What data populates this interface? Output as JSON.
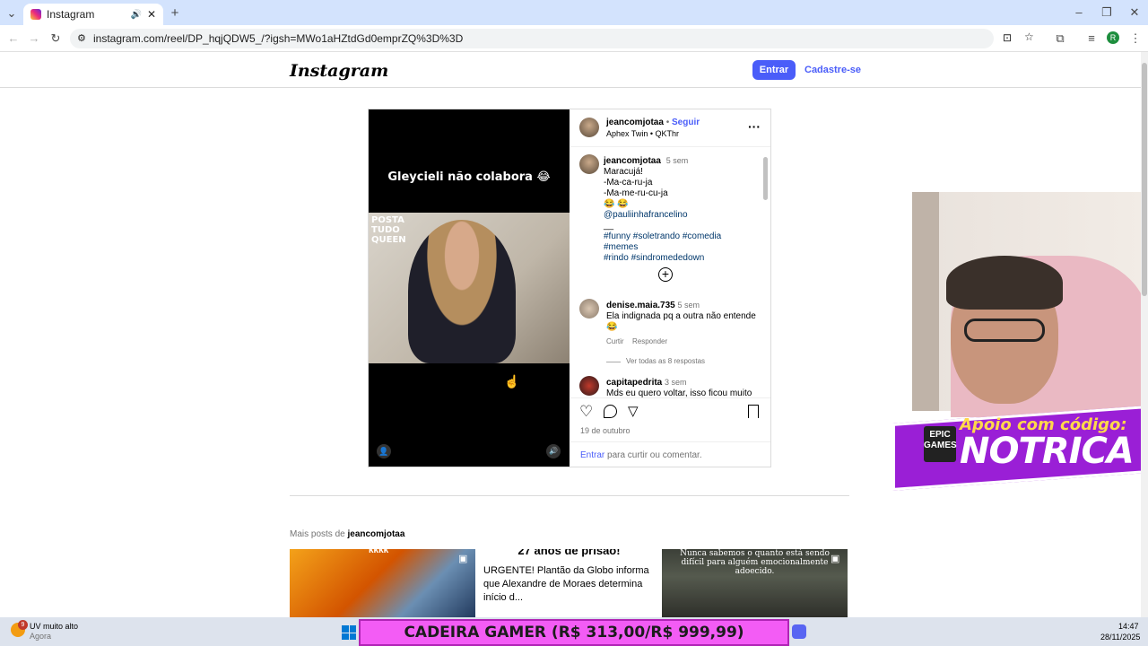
{
  "browser": {
    "tab_title": "Instagram",
    "url": "instagram.com/reel/DP_hqjQDW5_/?igsh=MWo1aHZtdGd0emprZQ%3D%3D"
  },
  "instagram": {
    "logo": "Instagram",
    "login_label": "Entrar",
    "signup_label": "Cadastre-se"
  },
  "post": {
    "video_caption": "Gleycieli não colabora 😂",
    "watermark": "POSTA TUDO QUEEN",
    "author": "jeancomjotaa",
    "follow_label": "Seguir",
    "dot": "•",
    "audio": "Aphex Twin • QKThr",
    "caption": {
      "user": "jeancomjotaa",
      "time": "5 sem",
      "lines": [
        "Maracujá!",
        "-Ma-ca-ru-ja",
        "-Ma-me-ru-cu-ja",
        "😂 😂"
      ],
      "mention": "@pauliinhafrancelino",
      "dash": "__",
      "hashtags_1": "#funny #soletrando #comedia #memes",
      "hashtags_2": "#rindo #sindromededown"
    },
    "comments": [
      {
        "user": "denise.maia.735",
        "time": "5 sem",
        "text_1": "Ela indignada pq a outra não entende",
        "text_2": "😂",
        "like": "Curtir",
        "reply": "Responder",
        "view_replies": "Ver todas as 8 respostas"
      },
      {
        "user": "capitapedrita",
        "time": "3 sem",
        "text_1": "Mds eu quero voltar, isso ficou muito"
      }
    ],
    "date": "19 de outubro",
    "login_prompt_link": "Entrar",
    "login_prompt_rest": " para curtir ou comentar."
  },
  "more_posts": {
    "label": "Mais posts de ",
    "user": "jeancomjotaa",
    "thumb1_text": "kkkk",
    "thumb2_title": "27 anos de prisão!",
    "thumb2_body": "URGENTE! Plantão da Globo informa que Alexandre de Moraes determina início d...",
    "thumb3_text": "Nunca sabemos o quanto está sendo difícil para alguém emocionalmente adoecido."
  },
  "overlay": {
    "apoio": "Apoio com código:",
    "code": "NOTRICA",
    "epic": "EPIC GAMES",
    "promo": "CADEIRA GAMER (R$ 313,00/R$ 999,99)"
  },
  "taskbar": {
    "weather": "UV muito alto",
    "weather_sub": "Agora",
    "badge": "9",
    "time": "14:47",
    "date": "28/11/2025"
  },
  "colors": {
    "accent": "#4a5df9",
    "tab_strip": "#d3e3fd",
    "banner": "#9a1fd6",
    "promo": "#f35cf5"
  }
}
